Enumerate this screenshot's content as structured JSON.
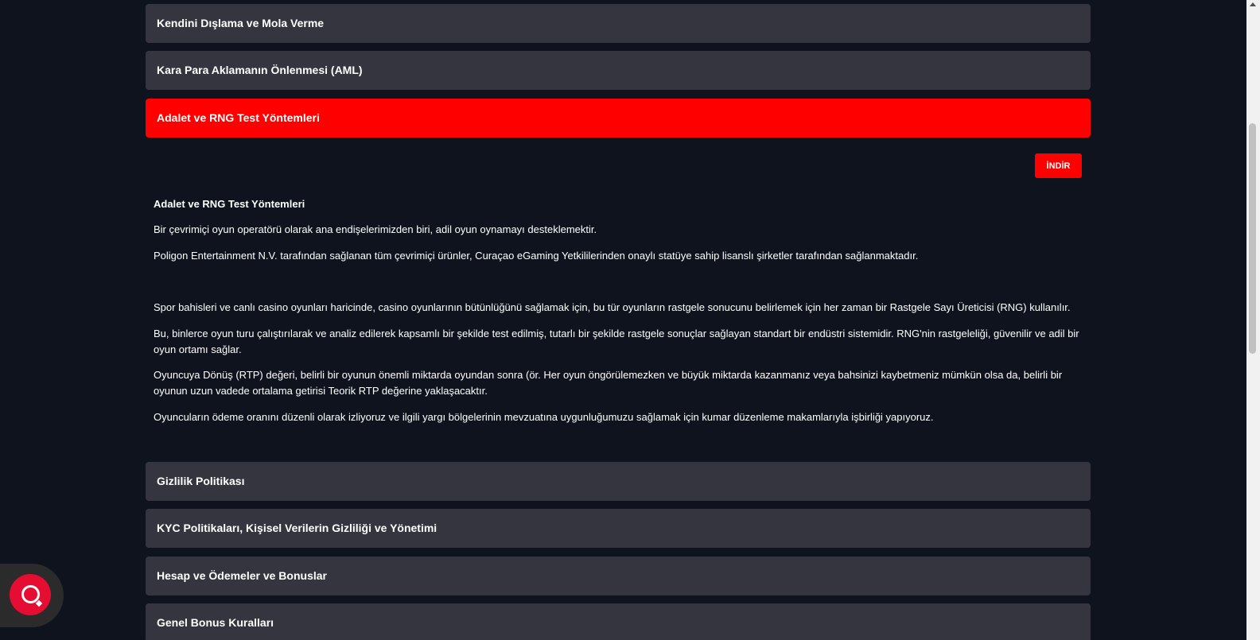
{
  "accordion_items_top": [
    {
      "label": "Kendini Dışlama ve Mola Verme"
    },
    {
      "label": "Kara Para Aklamanın Önlenmesi (AML)"
    }
  ],
  "active_item": {
    "label": "Adalet ve RNG Test Yöntemleri",
    "download_label": "İNDİR",
    "content_title": "Adalet ve RNG Test Yöntemleri",
    "paragraphs": [
      "Bir çevrimiçi oyun operatörü olarak ana endişelerimizden biri, adil oyun oynamayı desteklemektir.",
      "Poligon Entertainment N.V. tarafından sağlanan tüm çevrimiçi ürünler, Curaçao eGaming Yetkililerinden onaylı statüye sahip lisanslı şirketler tarafından sağlanmaktadır.",
      "Spor bahisleri ve canlı casino oyunları haricinde, casino oyunlarının bütünlüğünü sağlamak için, bu tür oyunların rastgele sonucunu belirlemek için her zaman bir Rastgele Sayı Üreticisi (RNG) kullanılır.",
      "Bu, binlerce oyun turu çalıştırılarak ve analiz edilerek kapsamlı bir şekilde test edilmiş, tutarlı bir şekilde rastgele sonuçlar sağlayan standart bir endüstri sistemidir. RNG'nin rastgeleliği, güvenilir ve adil bir oyun ortamı sağlar.",
      "Oyuncuya Dönüş (RTP) değeri, belirli bir oyunun önemli miktarda oyundan sonra (ör. Her oyun öngörülemezken ve büyük miktarda kazanmanız veya bahsinizi kaybetmeniz mümkün olsa da, belirli bir oyunun uzun vadede ortalama getirisi Teorik RTP değerine yaklaşacaktır.",
      "Oyuncuların ödeme oranını düzenli olarak izliyoruz ve ilgili yargı bölgelerinin mevzuatına uygunluğumuzu sağlamak için kumar düzenleme makamlarıyla işbirliği yapıyoruz."
    ]
  },
  "accordion_items_bottom": [
    {
      "label": "Gizlilik Politikası"
    },
    {
      "label": "KYC Politikaları, Kişisel Verilerin Gizliliği ve Yönetimi"
    },
    {
      "label": "Hesap ve Ödemeler ve Bonuslar"
    },
    {
      "label": "Genel Bonus Kuralları"
    }
  ],
  "colors": {
    "background": "#0f131e",
    "accordion": "#35353f",
    "accent": "#ff0000",
    "chat_button": "#e60d32"
  },
  "icons": {
    "chat": "chat-bubble-icon"
  }
}
